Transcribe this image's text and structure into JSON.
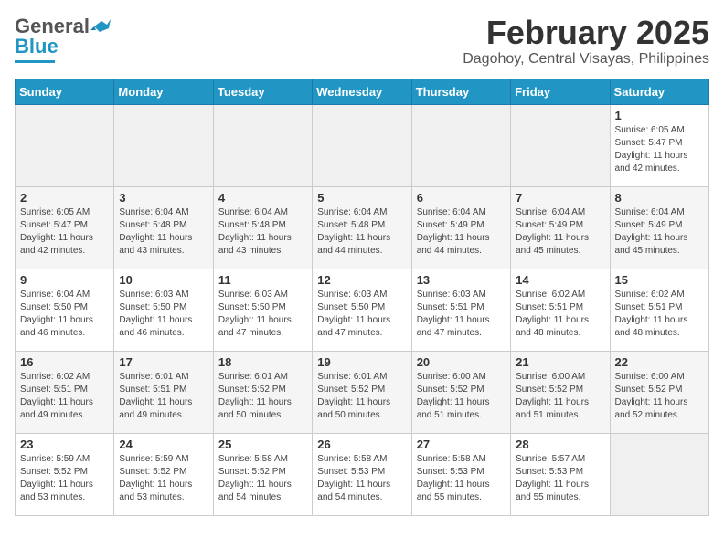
{
  "header": {
    "logo_general": "General",
    "logo_blue": "Blue",
    "month": "February 2025",
    "location": "Dagohoy, Central Visayas, Philippines"
  },
  "weekdays": [
    "Sunday",
    "Monday",
    "Tuesday",
    "Wednesday",
    "Thursday",
    "Friday",
    "Saturday"
  ],
  "weeks": [
    [
      {
        "day": "",
        "info": ""
      },
      {
        "day": "",
        "info": ""
      },
      {
        "day": "",
        "info": ""
      },
      {
        "day": "",
        "info": ""
      },
      {
        "day": "",
        "info": ""
      },
      {
        "day": "",
        "info": ""
      },
      {
        "day": "1",
        "info": "Sunrise: 6:05 AM\nSunset: 5:47 PM\nDaylight: 11 hours and 42 minutes."
      }
    ],
    [
      {
        "day": "2",
        "info": "Sunrise: 6:05 AM\nSunset: 5:47 PM\nDaylight: 11 hours and 42 minutes."
      },
      {
        "day": "3",
        "info": "Sunrise: 6:04 AM\nSunset: 5:48 PM\nDaylight: 11 hours and 43 minutes."
      },
      {
        "day": "4",
        "info": "Sunrise: 6:04 AM\nSunset: 5:48 PM\nDaylight: 11 hours and 43 minutes."
      },
      {
        "day": "5",
        "info": "Sunrise: 6:04 AM\nSunset: 5:48 PM\nDaylight: 11 hours and 44 minutes."
      },
      {
        "day": "6",
        "info": "Sunrise: 6:04 AM\nSunset: 5:49 PM\nDaylight: 11 hours and 44 minutes."
      },
      {
        "day": "7",
        "info": "Sunrise: 6:04 AM\nSunset: 5:49 PM\nDaylight: 11 hours and 45 minutes."
      },
      {
        "day": "8",
        "info": "Sunrise: 6:04 AM\nSunset: 5:49 PM\nDaylight: 11 hours and 45 minutes."
      }
    ],
    [
      {
        "day": "9",
        "info": "Sunrise: 6:04 AM\nSunset: 5:50 PM\nDaylight: 11 hours and 46 minutes."
      },
      {
        "day": "10",
        "info": "Sunrise: 6:03 AM\nSunset: 5:50 PM\nDaylight: 11 hours and 46 minutes."
      },
      {
        "day": "11",
        "info": "Sunrise: 6:03 AM\nSunset: 5:50 PM\nDaylight: 11 hours and 47 minutes."
      },
      {
        "day": "12",
        "info": "Sunrise: 6:03 AM\nSunset: 5:50 PM\nDaylight: 11 hours and 47 minutes."
      },
      {
        "day": "13",
        "info": "Sunrise: 6:03 AM\nSunset: 5:51 PM\nDaylight: 11 hours and 47 minutes."
      },
      {
        "day": "14",
        "info": "Sunrise: 6:02 AM\nSunset: 5:51 PM\nDaylight: 11 hours and 48 minutes."
      },
      {
        "day": "15",
        "info": "Sunrise: 6:02 AM\nSunset: 5:51 PM\nDaylight: 11 hours and 48 minutes."
      }
    ],
    [
      {
        "day": "16",
        "info": "Sunrise: 6:02 AM\nSunset: 5:51 PM\nDaylight: 11 hours and 49 minutes."
      },
      {
        "day": "17",
        "info": "Sunrise: 6:01 AM\nSunset: 5:51 PM\nDaylight: 11 hours and 49 minutes."
      },
      {
        "day": "18",
        "info": "Sunrise: 6:01 AM\nSunset: 5:52 PM\nDaylight: 11 hours and 50 minutes."
      },
      {
        "day": "19",
        "info": "Sunrise: 6:01 AM\nSunset: 5:52 PM\nDaylight: 11 hours and 50 minutes."
      },
      {
        "day": "20",
        "info": "Sunrise: 6:00 AM\nSunset: 5:52 PM\nDaylight: 11 hours and 51 minutes."
      },
      {
        "day": "21",
        "info": "Sunrise: 6:00 AM\nSunset: 5:52 PM\nDaylight: 11 hours and 51 minutes."
      },
      {
        "day": "22",
        "info": "Sunrise: 6:00 AM\nSunset: 5:52 PM\nDaylight: 11 hours and 52 minutes."
      }
    ],
    [
      {
        "day": "23",
        "info": "Sunrise: 5:59 AM\nSunset: 5:52 PM\nDaylight: 11 hours and 53 minutes."
      },
      {
        "day": "24",
        "info": "Sunrise: 5:59 AM\nSunset: 5:52 PM\nDaylight: 11 hours and 53 minutes."
      },
      {
        "day": "25",
        "info": "Sunrise: 5:58 AM\nSunset: 5:52 PM\nDaylight: 11 hours and 54 minutes."
      },
      {
        "day": "26",
        "info": "Sunrise: 5:58 AM\nSunset: 5:53 PM\nDaylight: 11 hours and 54 minutes."
      },
      {
        "day": "27",
        "info": "Sunrise: 5:58 AM\nSunset: 5:53 PM\nDaylight: 11 hours and 55 minutes."
      },
      {
        "day": "28",
        "info": "Sunrise: 5:57 AM\nSunset: 5:53 PM\nDaylight: 11 hours and 55 minutes."
      },
      {
        "day": "",
        "info": ""
      }
    ]
  ]
}
